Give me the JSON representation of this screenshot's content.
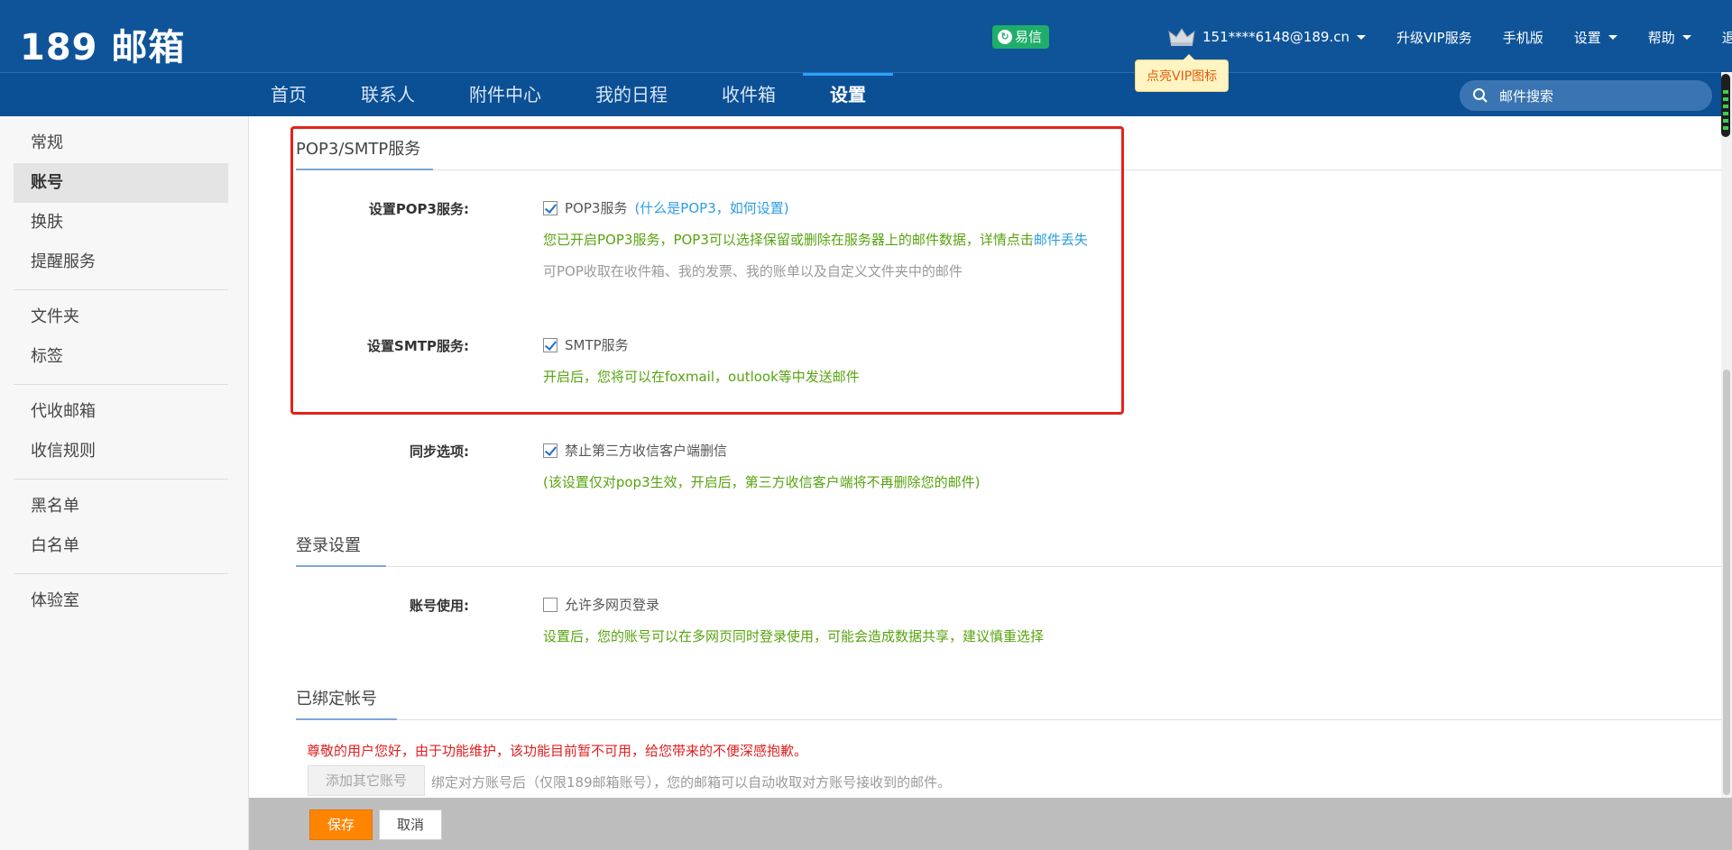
{
  "header": {
    "logo": "189 邮箱",
    "yixin_label": "易信",
    "account": "151****6148@189.cn",
    "upgrade_vip": "升级VIP服务",
    "mobile": "手机版",
    "settings": "设置",
    "help": "帮助",
    "logout": "退出",
    "vip_tip": "点亮VIP图标"
  },
  "nav": {
    "tabs": [
      "首页",
      "联系人",
      "附件中心",
      "我的日程",
      "收件箱",
      "设置"
    ],
    "active": "设置",
    "search_placeholder": "邮件搜索"
  },
  "sidebar": {
    "groups": [
      [
        "常规",
        "账号",
        "换肤",
        "提醒服务"
      ],
      [
        "文件夹",
        "标签"
      ],
      [
        "代收邮箱",
        "收信规则"
      ],
      [
        "黑名单",
        "白名单"
      ],
      [
        "体验室"
      ]
    ],
    "active": "账号"
  },
  "pop3smtp": {
    "title": "POP3/SMTP服务",
    "pop3_label": "设置POP3服务:",
    "pop3_checkbox": "POP3服务",
    "pop3_checked": true,
    "pop3_help": "(什么是POP3，如何设置)",
    "pop3_note_1": "您已开启POP3服务，POP3可以选择保留或删除在服务器上的邮件数据，详情点击",
    "pop3_note_link": "邮件丢失",
    "pop3_note_2": "可POP收取在收件箱、我的发票、我的账单以及自定义文件夹中的邮件",
    "smtp_label": "设置SMTP服务:",
    "smtp_checkbox": "SMTP服务",
    "smtp_checked": true,
    "smtp_note": "开启后，您将可以在foxmail，outlook等中发送邮件"
  },
  "sync": {
    "label": "同步选项:",
    "checkbox": "禁止第三方收信客户端删信",
    "checked": true,
    "note": "(该设置仅对pop3生效，开启后，第三方收信客户端将不再删除您的邮件)"
  },
  "login": {
    "title": "登录设置",
    "label": "账号使用:",
    "checkbox": "允许多网页登录",
    "checked": false,
    "note": "设置后，您的账号可以在多网页同时登录使用，可能会造成数据共享，建议慎重选择"
  },
  "bound": {
    "title": "已绑定帐号",
    "warning": "尊敬的用户您好，由于功能维护，该功能目前暂不可用，给您带来的不便深感抱歉。",
    "add_button": "添加其它账号",
    "note": "绑定对方账号后（仅限189邮箱账号），您的邮箱可以自动收取对方账号接收到的邮件。"
  },
  "footer": {
    "save": "保存",
    "cancel": "取消"
  },
  "colors": {
    "header_bg": "#0f5499",
    "accent_green": "#57a30f",
    "link_blue": "#2b9de0",
    "save_orange": "#ff8400",
    "highlight_red": "#e3231b"
  }
}
